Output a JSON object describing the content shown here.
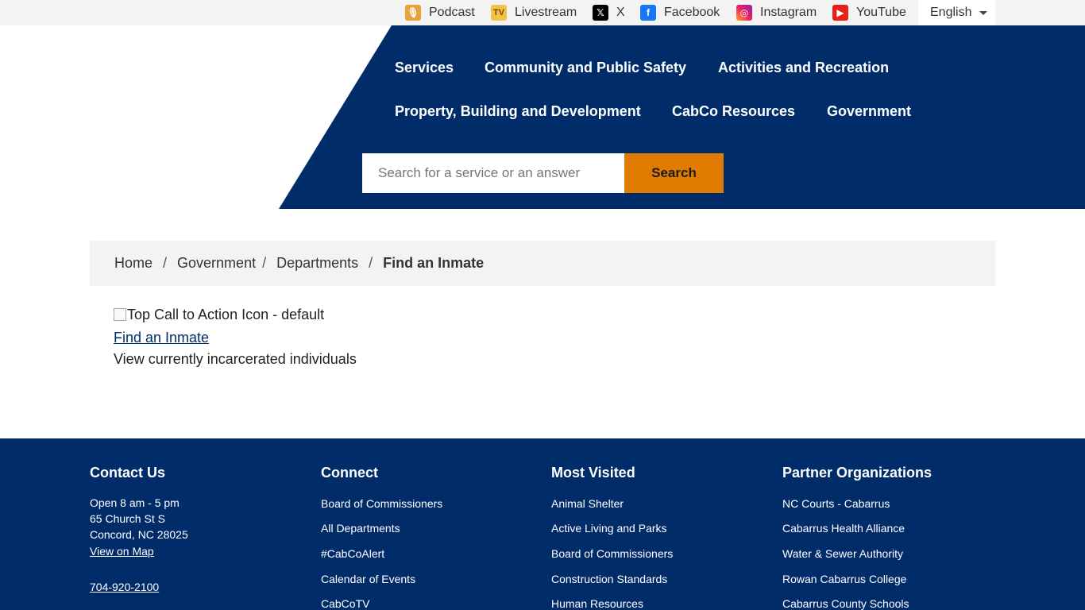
{
  "topbar": {
    "social": [
      {
        "label": "Podcast",
        "icon": "podcast-icon",
        "glyph": "🎙"
      },
      {
        "label": "Livestream",
        "icon": "livestream-icon",
        "glyph": "TV"
      },
      {
        "label": "X",
        "icon": "x-icon",
        "glyph": "𝕏"
      },
      {
        "label": "Facebook",
        "icon": "facebook-icon",
        "glyph": "f"
      },
      {
        "label": "Instagram",
        "icon": "instagram-icon",
        "glyph": "◎"
      },
      {
        "label": "YouTube",
        "icon": "youtube-icon",
        "glyph": "▶"
      }
    ],
    "language": "English"
  },
  "nav": {
    "items": [
      "Services",
      "Community and Public Safety",
      "Activities and Recreation",
      "Property, Building and Development",
      "CabCo Resources",
      "Government"
    ]
  },
  "search": {
    "placeholder": "Search for a service or an answer",
    "button": "Search"
  },
  "breadcrumb": {
    "items": [
      "Home",
      "Government",
      "Departments"
    ],
    "current": "Find an Inmate"
  },
  "content": {
    "image_alt": "Top Call to Action Icon - default",
    "link": "Find an Inmate",
    "description": "View currently incarcerated individuals"
  },
  "footer": {
    "contact": {
      "heading": "Contact Us",
      "hours": "Open 8 am - 5 pm",
      "street": "65 Church St S",
      "city": "Concord, NC 28025",
      "map_link": "View on Map",
      "phone": "704-920-2100"
    },
    "connect": {
      "heading": "Connect",
      "links": [
        "Board of Commissioners",
        "All Departments",
        "#CabCoAlert",
        "Calendar of Events",
        "CabCoTV"
      ]
    },
    "most_visited": {
      "heading": "Most Visited",
      "links": [
        "Animal Shelter",
        "Active Living and Parks",
        "Board of Commissioners",
        "Construction Standards",
        "Human Resources"
      ]
    },
    "partners": {
      "heading": "Partner Organizations",
      "links": [
        "NC Courts - Cabarrus",
        "Cabarrus Health Alliance",
        "Water & Sewer Authority",
        "Rowan Cabarrus College",
        "Cabarrus County Schools"
      ]
    }
  },
  "colors": {
    "navy": "#002d6a",
    "orange": "#e07a00",
    "light_gray": "#f3f3f3"
  }
}
